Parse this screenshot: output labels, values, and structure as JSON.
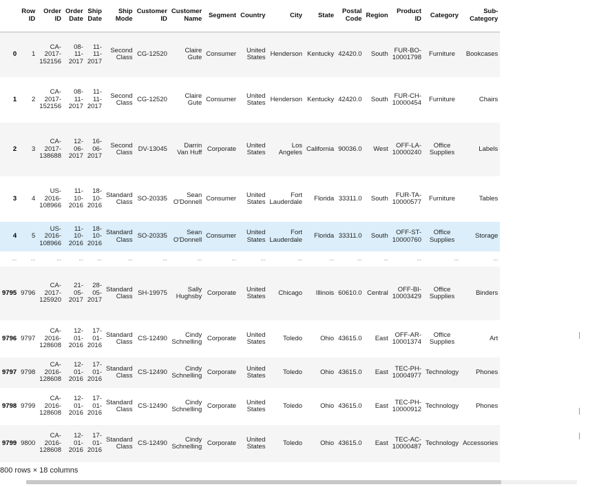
{
  "table": {
    "columns": [
      "",
      "Row ID",
      "Order ID",
      "Order Date",
      "Ship Date",
      "Ship Mode",
      "Customer ID",
      "Customer Name",
      "Segment",
      "Country",
      "City",
      "State",
      "Postal Code",
      "Region",
      "Product ID",
      "Category",
      "Sub-Category"
    ],
    "columns_display": [
      [
        ""
      ],
      [
        "Row",
        "ID"
      ],
      [
        "Order",
        "ID"
      ],
      [
        "Order",
        "Date"
      ],
      [
        "Ship",
        "Date"
      ],
      [
        "Ship",
        "Mode"
      ],
      [
        "Customer",
        "ID"
      ],
      [
        "Customer",
        "Name"
      ],
      [
        "Segment"
      ],
      [
        "Country"
      ],
      [
        "City"
      ],
      [
        "State"
      ],
      [
        "Postal",
        "Code"
      ],
      [
        "Region"
      ],
      [
        "Product",
        "ID"
      ],
      [
        "Category"
      ],
      [
        "Sub-",
        "Category"
      ]
    ],
    "rows": [
      {
        "index": "0",
        "row_id": "1",
        "order_id": [
          "CA-",
          "2017-",
          "152156"
        ],
        "order_date": [
          "08-",
          "11-",
          "2017"
        ],
        "ship_date": [
          "11-",
          "11-",
          "2017"
        ],
        "ship_mode": [
          "Second",
          "Class"
        ],
        "customer_id": "CG-12520",
        "customer_name": [
          "Claire",
          "Gute"
        ],
        "segment": "Consumer",
        "country": [
          "United",
          "States"
        ],
        "city": [
          "Henderson"
        ],
        "state": "Kentucky",
        "postal_code": "42420.0",
        "region": "South",
        "product_id": [
          "FUR-BO-",
          "10001798"
        ],
        "category": [
          "Furniture"
        ],
        "sub_category": "Bookcases"
      },
      {
        "index": "1",
        "row_id": "2",
        "order_id": [
          "CA-",
          "2017-",
          "152156"
        ],
        "order_date": [
          "08-",
          "11-",
          "2017"
        ],
        "ship_date": [
          "11-",
          "11-",
          "2017"
        ],
        "ship_mode": [
          "Second",
          "Class"
        ],
        "customer_id": "CG-12520",
        "customer_name": [
          "Claire",
          "Gute"
        ],
        "segment": "Consumer",
        "country": [
          "United",
          "States"
        ],
        "city": [
          "Henderson"
        ],
        "state": "Kentucky",
        "postal_code": "42420.0",
        "region": "South",
        "product_id": [
          "FUR-CH-",
          "10000454"
        ],
        "category": [
          "Furniture"
        ],
        "sub_category": "Chairs"
      },
      {
        "index": "2",
        "row_id": "3",
        "order_id": [
          "CA-",
          "2017-",
          "138688"
        ],
        "order_date": [
          "12-",
          "06-",
          "2017"
        ],
        "ship_date": [
          "16-",
          "06-",
          "2017"
        ],
        "ship_mode": [
          "Second",
          "Class"
        ],
        "customer_id": "DV-13045",
        "customer_name": [
          "Darrin",
          "Van Huff"
        ],
        "segment": "Corporate",
        "country": [
          "United",
          "States"
        ],
        "city": [
          "Los",
          "Angeles"
        ],
        "state": "California",
        "postal_code": "90036.0",
        "region": "West",
        "product_id": [
          "OFF-LA-",
          "10000240"
        ],
        "category": [
          "Office",
          "Supplies"
        ],
        "sub_category": "Labels"
      },
      {
        "index": "3",
        "row_id": "4",
        "order_id": [
          "US-",
          "2016-",
          "108966"
        ],
        "order_date": [
          "11-",
          "10-",
          "2016"
        ],
        "ship_date": [
          "18-",
          "10-",
          "2016"
        ],
        "ship_mode": [
          "Standard",
          "Class"
        ],
        "customer_id": "SO-20335",
        "customer_name": [
          "Sean",
          "O'Donnell"
        ],
        "segment": "Consumer",
        "country": [
          "United",
          "States"
        ],
        "city": [
          "Fort",
          "Lauderdale"
        ],
        "state": "Florida",
        "postal_code": "33311.0",
        "region": "South",
        "product_id": [
          "FUR-TA-",
          "10000577"
        ],
        "category": [
          "Furniture"
        ],
        "sub_category": "Tables"
      },
      {
        "index": "4",
        "row_id": "5",
        "order_id": [
          "US-",
          "2016-",
          "108966"
        ],
        "order_date": [
          "11-",
          "10-",
          "2016"
        ],
        "ship_date": [
          "18-",
          "10-",
          "2016"
        ],
        "ship_mode": [
          "Standard",
          "Class"
        ],
        "customer_id": "SO-20335",
        "customer_name": [
          "Sean",
          "O'Donnell"
        ],
        "segment": "Consumer",
        "country": [
          "United",
          "States"
        ],
        "city": [
          "Fort",
          "Lauderdale"
        ],
        "state": "Florida",
        "postal_code": "33311.0",
        "region": "South",
        "product_id": [
          "OFF-ST-",
          "10000760"
        ],
        "category": [
          "Office",
          "Supplies"
        ],
        "sub_category": "Storage",
        "highlight": true
      },
      {
        "ellipsis": true,
        "value": "..."
      },
      {
        "index": "9795",
        "row_id": "9796",
        "order_id": [
          "CA-",
          "2017-",
          "125920"
        ],
        "order_date": [
          "21-",
          "05-",
          "2017"
        ],
        "ship_date": [
          "28-",
          "05-",
          "2017"
        ],
        "ship_mode": [
          "Standard",
          "Class"
        ],
        "customer_id": "SH-19975",
        "customer_name": [
          "Sally",
          "Hughsby"
        ],
        "segment": "Corporate",
        "country": [
          "United",
          "States"
        ],
        "city": [
          "Chicago"
        ],
        "state": "Illinois",
        "postal_code": "60610.0",
        "region": "Central",
        "product_id": [
          "OFF-BI-",
          "10003429"
        ],
        "category": [
          "Office",
          "Supplies"
        ],
        "sub_category": "Binders"
      },
      {
        "index": "9796",
        "row_id": "9797",
        "order_id": [
          "CA-",
          "2016-",
          "128608"
        ],
        "order_date": [
          "12-",
          "01-",
          "2016"
        ],
        "ship_date": [
          "17-",
          "01-",
          "2016"
        ],
        "ship_mode": [
          "Standard",
          "Class"
        ],
        "customer_id": "CS-12490",
        "customer_name": [
          "Cindy",
          "Schnelling"
        ],
        "segment": "Corporate",
        "country": [
          "United",
          "States"
        ],
        "city": [
          "Toledo"
        ],
        "state": "Ohio",
        "postal_code": "43615.0",
        "region": "East",
        "product_id": [
          "OFF-AR-",
          "10001374"
        ],
        "category": [
          "Office",
          "Supplies"
        ],
        "sub_category": "Art"
      },
      {
        "index": "9797",
        "row_id": "9798",
        "order_id": [
          "CA-",
          "2016-",
          "128608"
        ],
        "order_date": [
          "12-",
          "01-",
          "2016"
        ],
        "ship_date": [
          "17-",
          "01-",
          "2016"
        ],
        "ship_mode": [
          "Standard",
          "Class"
        ],
        "customer_id": "CS-12490",
        "customer_name": [
          "Cindy",
          "Schnelling"
        ],
        "segment": "Corporate",
        "country": [
          "United",
          "States"
        ],
        "city": [
          "Toledo"
        ],
        "state": "Ohio",
        "postal_code": "43615.0",
        "region": "East",
        "product_id": [
          "TEC-PH-",
          "10004977"
        ],
        "category": [
          "Technology"
        ],
        "sub_category": "Phones"
      },
      {
        "index": "9798",
        "row_id": "9799",
        "order_id": [
          "CA-",
          "2016-",
          "128608"
        ],
        "order_date": [
          "12-",
          "01-",
          "2016"
        ],
        "ship_date": [
          "17-",
          "01-",
          "2016"
        ],
        "ship_mode": [
          "Standard",
          "Class"
        ],
        "customer_id": "CS-12490",
        "customer_name": [
          "Cindy",
          "Schnelling"
        ],
        "segment": "Corporate",
        "country": [
          "United",
          "States"
        ],
        "city": [
          "Toledo"
        ],
        "state": "Ohio",
        "postal_code": "43615.0",
        "region": "East",
        "product_id": [
          "TEC-PH-",
          "10000912"
        ],
        "category": [
          "Technology"
        ],
        "sub_category": "Phones"
      },
      {
        "index": "9799",
        "row_id": "9800",
        "order_id": [
          "CA-",
          "2016-",
          "128608"
        ],
        "order_date": [
          "12-",
          "01-",
          "2016"
        ],
        "ship_date": [
          "17-",
          "01-",
          "2016"
        ],
        "ship_mode": [
          "Standard",
          "Class"
        ],
        "customer_id": "CS-12490",
        "customer_name": [
          "Cindy",
          "Schnelling"
        ],
        "segment": "Corporate",
        "country": [
          "United",
          "States"
        ],
        "city": [
          "Toledo"
        ],
        "state": "Ohio",
        "postal_code": "43615.0",
        "region": "East",
        "product_id": [
          "TEC-AC-",
          "10000487"
        ],
        "category": [
          "Technology"
        ],
        "sub_category": "Accessories"
      }
    ]
  },
  "footer": {
    "summary": "800 rows × 18 columns"
  },
  "colors": {
    "row_highlight": "#dbeefa",
    "row_stripe": "#f5f5f5"
  }
}
